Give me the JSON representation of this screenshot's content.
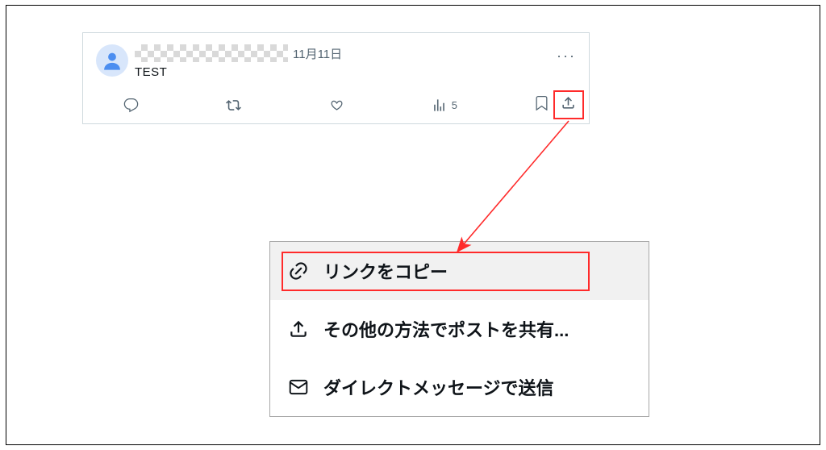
{
  "tweet": {
    "timestamp": "11月11日",
    "text": "TEST",
    "views": "5"
  },
  "menu": {
    "copy_link": "リンクをコピー",
    "share_via": "その他の方法でポストを共有...",
    "send_dm": "ダイレクトメッセージで送信"
  }
}
